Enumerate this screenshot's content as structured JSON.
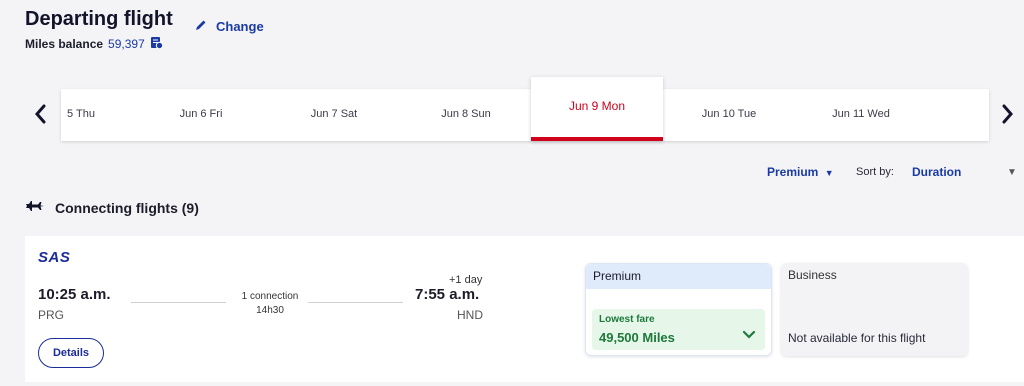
{
  "header": {
    "title": "Departing flight",
    "change_label": "Change",
    "miles_label": "Miles balance",
    "miles_value": "59,397"
  },
  "dates": {
    "items": [
      "5 Thu",
      "Jun 6 Fri",
      "Jun 7 Sat",
      "Jun 8 Sun",
      "Jun 10 Tue",
      "Jun 11 Wed"
    ],
    "selected": "Jun 9 Mon"
  },
  "filters": {
    "cabin": "Premium",
    "sort_label": "Sort by:",
    "sort_value": "Duration"
  },
  "results": {
    "title": "Connecting flights (9)"
  },
  "flight": {
    "airline": "SAS",
    "dep_time": "10:25 a.m.",
    "dep_code": "PRG",
    "connection": "1 connection",
    "duration": "14h30",
    "plus_day": "+1 day",
    "arr_time": "7:55 a.m.",
    "arr_code": "HND",
    "details_label": "Details"
  },
  "fares": {
    "premium": {
      "title": "Premium",
      "tag": "Lowest fare",
      "miles": "49,500 Miles"
    },
    "business": {
      "title": "Business",
      "note": "Not available for this flight"
    }
  },
  "colors": {
    "brand_blue": "#1a3aa6",
    "selected_red": "#d0021b",
    "fare_green": "#1d7a3a"
  }
}
